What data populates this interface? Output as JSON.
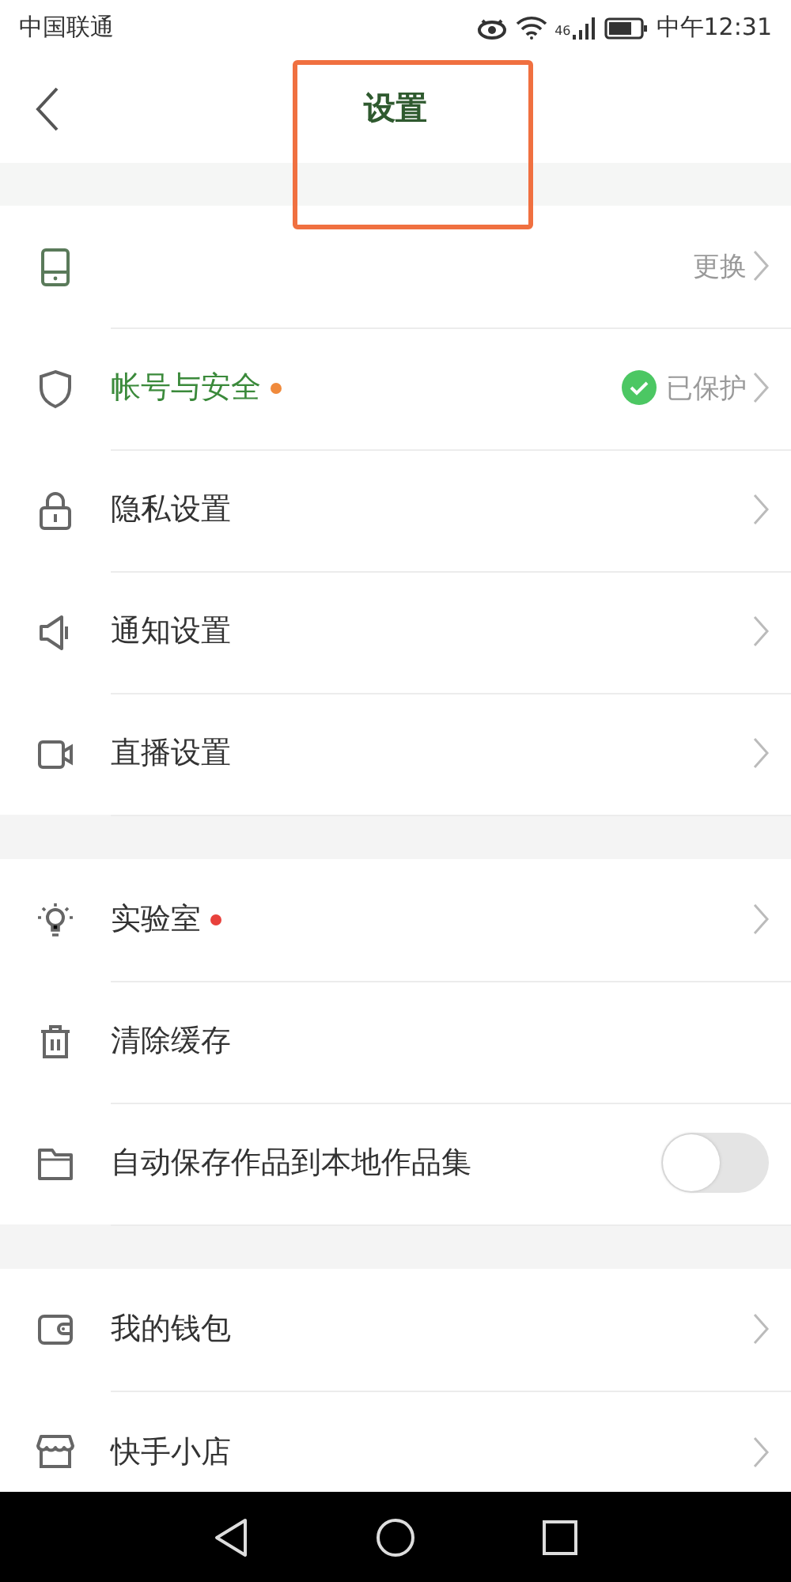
{
  "status_bar": {
    "carrier": "中国联通",
    "network": "46",
    "time": "中午12:31"
  },
  "header": {
    "title": "设置",
    "highlight_box": true
  },
  "groups": [
    {
      "items": [
        {
          "kind": "link",
          "value": "更换",
          "accent": true
        },
        {
          "kind": "link",
          "label": "帐号与安全",
          "accent": true,
          "color": "#f08a3c",
          "value": "已保护",
          "verified": true
        },
        {
          "kind": "link",
          "label": "隐私设置"
        },
        {
          "kind": "link",
          "label": "通知设置"
        },
        {
          "kind": "link",
          "label": "直播设置"
        }
      ]
    },
    {
      "items": [
        {
          "kind": "link",
          "label": "实验室",
          "color": "#e8413c"
        },
        {
          "kind": "action",
          "label": "清除缓存"
        },
        {
          "kind": "toggle",
          "label": "自动保存作品到本地作品集",
          "on": false
        }
      ]
    },
    {
      "items": [
        {
          "kind": "link",
          "label": "我的钱包"
        },
        {
          "kind": "link",
          "label": "快手小店"
        }
      ]
    }
  ]
}
